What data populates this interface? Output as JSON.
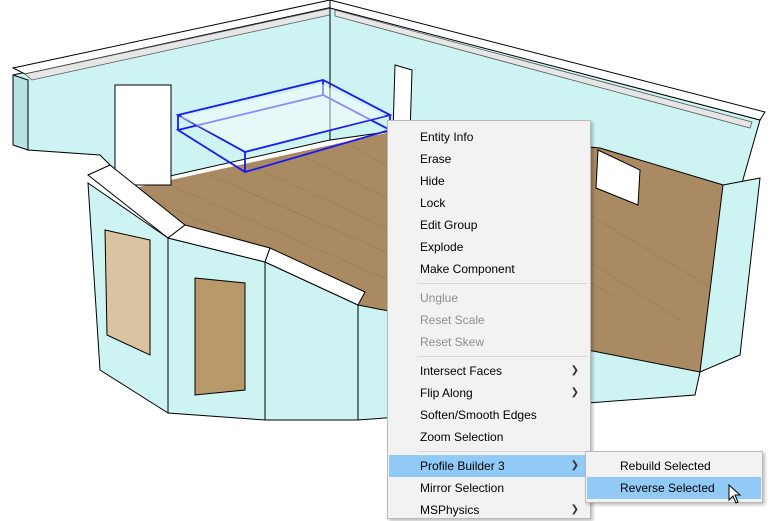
{
  "context_menu": {
    "items": [
      {
        "label": "Entity Info"
      },
      {
        "label": "Erase"
      },
      {
        "label": "Hide"
      },
      {
        "label": "Lock"
      },
      {
        "label": "Edit Group"
      },
      {
        "label": "Explode"
      },
      {
        "label": "Make Component"
      },
      {
        "label": "Unglue"
      },
      {
        "label": "Reset Scale"
      },
      {
        "label": "Reset Skew"
      },
      {
        "label": "Intersect Faces"
      },
      {
        "label": "Flip Along"
      },
      {
        "label": "Soften/Smooth Edges"
      },
      {
        "label": "Zoom Selection"
      },
      {
        "label": "Profile Builder 3"
      },
      {
        "label": "Mirror Selection"
      },
      {
        "label": "MSPhysics"
      }
    ]
  },
  "submenu": {
    "items": [
      {
        "label": "Rebuild Selected"
      },
      {
        "label": "Reverse Selected"
      }
    ]
  },
  "icons": {
    "submenu_arrow": "chevron-right-icon",
    "cursor": "mouse-pointer-icon"
  },
  "colors": {
    "wall": "#cdf3f3",
    "floor": "#a98a62",
    "selection": "#1a1af0",
    "menu_bg": "#f2f2f2",
    "highlight": "#91c9f7"
  }
}
